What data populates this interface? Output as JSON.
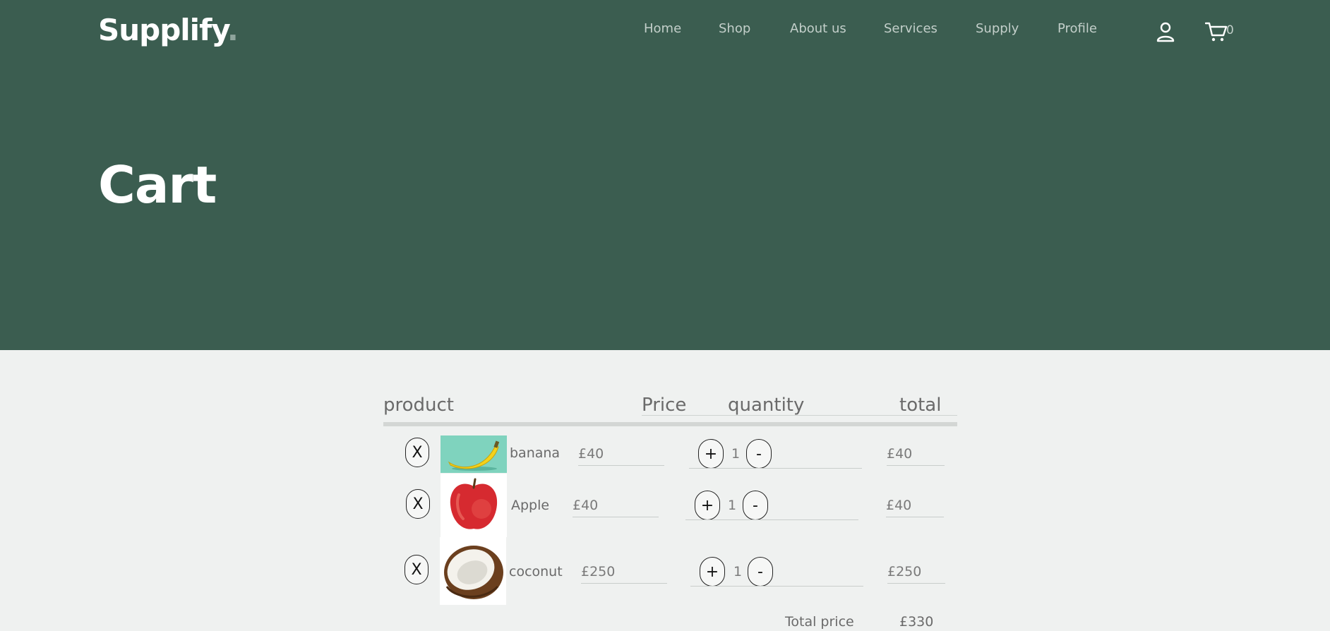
{
  "header": {
    "logo": "Supplify",
    "logo_dot": ".",
    "nav": [
      "Home",
      "Shop",
      "About us",
      "Services",
      "Supply",
      "Profile"
    ],
    "cart_count": "0"
  },
  "hero": {
    "title": "Cart"
  },
  "table": {
    "headers": {
      "product": "product",
      "price": "Price",
      "quantity": "quantity",
      "total": "total"
    }
  },
  "items": [
    {
      "remove": "X",
      "name": "banana",
      "price": "£40",
      "plus": "+",
      "qty": "1",
      "minus": "-",
      "total": "£40"
    },
    {
      "remove": "X",
      "name": "Apple",
      "price": "£40",
      "plus": "+",
      "qty": "1",
      "minus": "-",
      "total": "£40"
    },
    {
      "remove": "X",
      "name": "coconut",
      "price": "£250",
      "plus": "+",
      "qty": "1",
      "minus": "-",
      "total": "£250"
    }
  ],
  "summary": {
    "label": "Total price",
    "value": "£330"
  },
  "colors": {
    "hero_bg": "#3b5d50",
    "page_bg": "#eff1f0",
    "nav_text": "#c3cfca"
  }
}
